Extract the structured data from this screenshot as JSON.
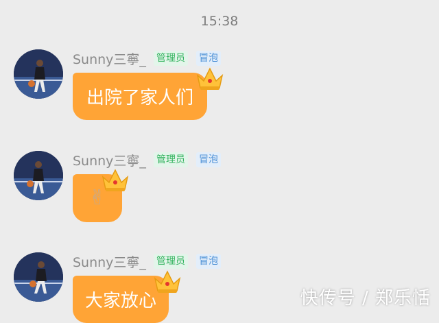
{
  "chat": {
    "timestamp": "15:38",
    "messages": [
      {
        "nickname": "Sunny三寧_",
        "badge_admin": "管理员",
        "badge_bubble": "冒泡",
        "content": "出院了家人们",
        "avatar_icon": "basketball-player-avatar"
      },
      {
        "nickname": "Sunny三寧_",
        "badge_admin": "管理员",
        "badge_bubble": "冒泡",
        "content": "✌",
        "avatar_icon": "basketball-player-avatar"
      },
      {
        "nickname": "Sunny三寧_",
        "badge_admin": "管理员",
        "badge_bubble": "冒泡",
        "content": "大家放心",
        "avatar_icon": "basketball-player-avatar"
      }
    ]
  },
  "watermark": "快传号 / 郑乐恬",
  "colors": {
    "background": "#ececec",
    "bubble": "#ffa436",
    "admin_badge_text": "#33b35e",
    "bubble_badge_text": "#4a8fd6",
    "crown": "#ffc23a"
  }
}
